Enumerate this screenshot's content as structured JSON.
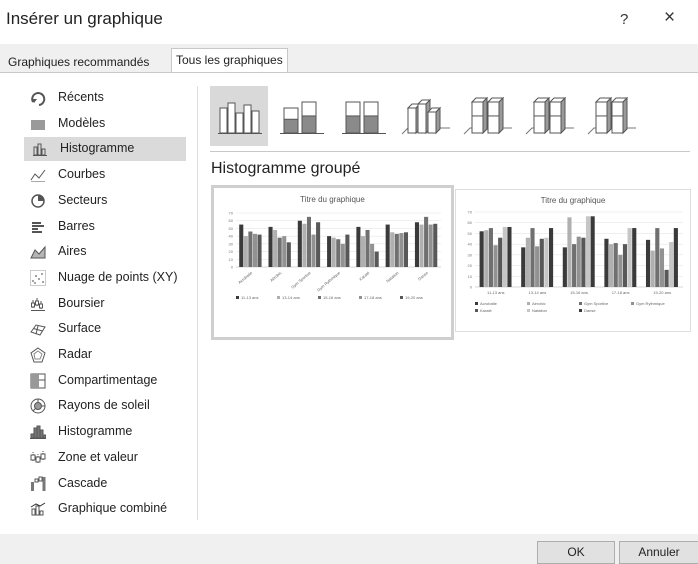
{
  "dialog": {
    "title": "Insérer un graphique",
    "help": "?",
    "close": "×"
  },
  "tabs": [
    {
      "label": "Graphiques recommandés",
      "selected": false
    },
    {
      "label": "Tous les graphiques",
      "selected": true
    }
  ],
  "sidebar": {
    "items": [
      {
        "label": "Récents",
        "icon": "recent-icon"
      },
      {
        "label": "Modèles",
        "icon": "folder-icon"
      },
      {
        "label": "Histogramme",
        "icon": "column-chart-icon",
        "selected": true
      },
      {
        "label": "Courbes",
        "icon": "line-chart-icon"
      },
      {
        "label": "Secteurs",
        "icon": "pie-chart-icon"
      },
      {
        "label": "Barres",
        "icon": "bar-chart-icon"
      },
      {
        "label": "Aires",
        "icon": "area-chart-icon"
      },
      {
        "label": "Nuage de points (XY)",
        "icon": "scatter-chart-icon"
      },
      {
        "label": "Boursier",
        "icon": "stock-chart-icon"
      },
      {
        "label": "Surface",
        "icon": "surface-chart-icon"
      },
      {
        "label": "Radar",
        "icon": "radar-chart-icon"
      },
      {
        "label": "Compartimentage",
        "icon": "treemap-chart-icon"
      },
      {
        "label": "Rayons de soleil",
        "icon": "sunburst-chart-icon"
      },
      {
        "label": "Histogramme",
        "icon": "histogram-chart-icon"
      },
      {
        "label": "Zone et valeur",
        "icon": "box-whisker-chart-icon"
      },
      {
        "label": "Cascade",
        "icon": "waterfall-chart-icon"
      },
      {
        "label": "Graphique combiné",
        "icon": "combo-chart-icon"
      }
    ]
  },
  "subtypes": [
    {
      "name": "clustered-column",
      "selected": true
    },
    {
      "name": "stacked-column"
    },
    {
      "name": "100-stacked-column"
    },
    {
      "name": "3d-clustered-column"
    },
    {
      "name": "3d-stacked-column"
    },
    {
      "name": "3d-100-stacked-column"
    },
    {
      "name": "3d-column"
    }
  ],
  "subtype_heading": "Histogramme groupé",
  "colors": {
    "series": [
      "#3a3a3a",
      "#b0b0b0",
      "#707070",
      "#929292",
      "#585858",
      "#c6c6c6"
    ],
    "selection": "#d9d9d9"
  },
  "chart_data": [
    {
      "type": "bar",
      "title": "Titre du graphique",
      "categories": [
        "Acrobatie",
        "Aérobic",
        "Gym Sportive",
        "Gym Rythmique",
        "Karaté",
        "Natation",
        "Danse"
      ],
      "ylim": [
        0,
        70
      ],
      "yticks": [
        "70",
        "60",
        "50",
        "40",
        "30",
        "20",
        "10",
        "0"
      ],
      "series": [
        {
          "name": "11-13 ans",
          "values": [
            55,
            52,
            60,
            40,
            52,
            55,
            58
          ]
        },
        {
          "name": "13-14 ans",
          "values": [
            40,
            48,
            56,
            38,
            40,
            45,
            55
          ]
        },
        {
          "name": "15-16 ans",
          "values": [
            46,
            38,
            65,
            36,
            48,
            43,
            65
          ]
        },
        {
          "name": "17-18 ans",
          "values": [
            43,
            40,
            42,
            30,
            30,
            44,
            55
          ]
        },
        {
          "name": "19-20 ans",
          "values": [
            42,
            32,
            58,
            42,
            20,
            45,
            56
          ]
        }
      ],
      "legend": "bottom",
      "grid": true
    },
    {
      "type": "bar",
      "title": "Titre du graphique",
      "categories": [
        "11-13 ans",
        "13-14 ans",
        "15-16 ans",
        "17-18 ans",
        "19-20 ans"
      ],
      "ylim": [
        0,
        70
      ],
      "yticks": [
        "70",
        "60",
        "50",
        "40",
        "30",
        "20",
        "10",
        "0"
      ],
      "series": [
        {
          "name": "Acrobatie",
          "values": [
            52,
            37,
            37,
            45,
            44
          ]
        },
        {
          "name": "Aérobic",
          "values": [
            53,
            46,
            65,
            40,
            34
          ]
        },
        {
          "name": "Gym Sportive",
          "values": [
            55,
            55,
            40,
            41,
            55
          ]
        },
        {
          "name": "Gym Rythmique",
          "values": [
            39,
            38,
            47,
            30,
            36
          ]
        },
        {
          "name": "Karaté",
          "values": [
            46,
            45,
            46,
            40,
            16
          ]
        },
        {
          "name": "Natation",
          "values": [
            56,
            46,
            66,
            55,
            42
          ]
        },
        {
          "name": "Danse",
          "values": [
            56,
            55,
            66,
            55,
            55
          ]
        }
      ],
      "legend": "bottom",
      "grid": true
    }
  ],
  "buttons": {
    "ok": "OK",
    "cancel": "Annuler"
  }
}
